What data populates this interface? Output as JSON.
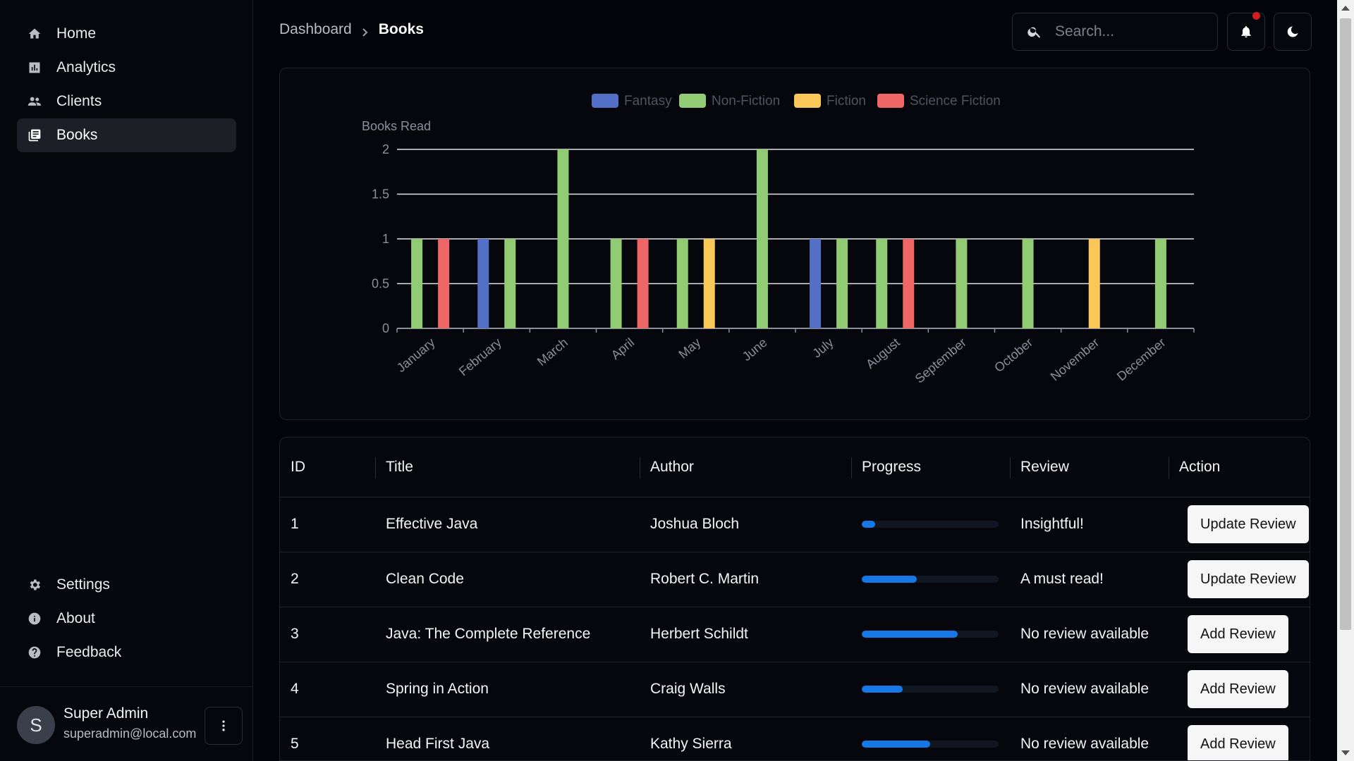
{
  "sidebar": {
    "items": [
      {
        "label": "Home",
        "icon": "home-icon",
        "active": false
      },
      {
        "label": "Analytics",
        "icon": "analytics-icon",
        "active": false
      },
      {
        "label": "Clients",
        "icon": "users-icon",
        "active": false
      },
      {
        "label": "Books",
        "icon": "books-icon",
        "active": true
      }
    ],
    "bottom_items": [
      {
        "label": "Settings",
        "icon": "gear-icon"
      },
      {
        "label": "About",
        "icon": "info-icon"
      },
      {
        "label": "Feedback",
        "icon": "help-icon"
      }
    ],
    "user": {
      "initial": "S",
      "name": "Super Admin",
      "email": "superadmin@local.com"
    }
  },
  "header": {
    "breadcrumb": {
      "parent": "Dashboard",
      "current": "Books"
    },
    "search": {
      "placeholder": "Search..."
    }
  },
  "colors": {
    "Fantasy": "#5470c6",
    "Non-Fiction": "#91cc75",
    "Fiction": "#fac858",
    "Science Fiction": "#ee6666",
    "accent": "#1677e6"
  },
  "chart_data": {
    "type": "bar",
    "title": "",
    "ylabel": "Books Read",
    "xlabel": "",
    "ylim": [
      0,
      2
    ],
    "yticks": [
      "0",
      "0.5",
      "1",
      "1.5",
      "2"
    ],
    "legend_position": "top-center",
    "categories": [
      "January",
      "February",
      "March",
      "April",
      "May",
      "June",
      "July",
      "August",
      "September",
      "October",
      "November",
      "December"
    ],
    "series": [
      {
        "name": "Fantasy",
        "values": [
          0,
          1,
          0,
          0,
          0,
          0,
          1,
          0,
          0,
          0,
          0,
          0
        ]
      },
      {
        "name": "Non-Fiction",
        "values": [
          1,
          1,
          2,
          1,
          1,
          2,
          1,
          1,
          1,
          1,
          0,
          1
        ]
      },
      {
        "name": "Fiction",
        "values": [
          0,
          0,
          0,
          0,
          1,
          0,
          0,
          0,
          0,
          0,
          1,
          0
        ]
      },
      {
        "name": "Science Fiction",
        "values": [
          1,
          0,
          0,
          1,
          0,
          0,
          0,
          1,
          0,
          0,
          0,
          0
        ]
      }
    ]
  },
  "table": {
    "headers": [
      "ID",
      "Title",
      "Author",
      "Progress",
      "Review",
      "Action"
    ],
    "rows": [
      {
        "id": "1",
        "title": "Effective Java",
        "author": "Joshua Bloch",
        "progress": 0.1,
        "review": "Insightful!",
        "action": "Update Review"
      },
      {
        "id": "2",
        "title": "Clean Code",
        "author": "Robert C. Martin",
        "progress": 0.4,
        "review": "A must read!",
        "action": "Update Review"
      },
      {
        "id": "3",
        "title": "Java: The Complete Reference",
        "author": "Herbert Schildt",
        "progress": 0.7,
        "review": "No review available",
        "action": "Add Review"
      },
      {
        "id": "4",
        "title": "Spring in Action",
        "author": "Craig Walls",
        "progress": 0.3,
        "review": "No review available",
        "action": "Add Review"
      },
      {
        "id": "5",
        "title": "Head First Java",
        "author": "Kathy Sierra",
        "progress": 0.5,
        "review": "No review available",
        "action": "Add Review"
      }
    ]
  }
}
